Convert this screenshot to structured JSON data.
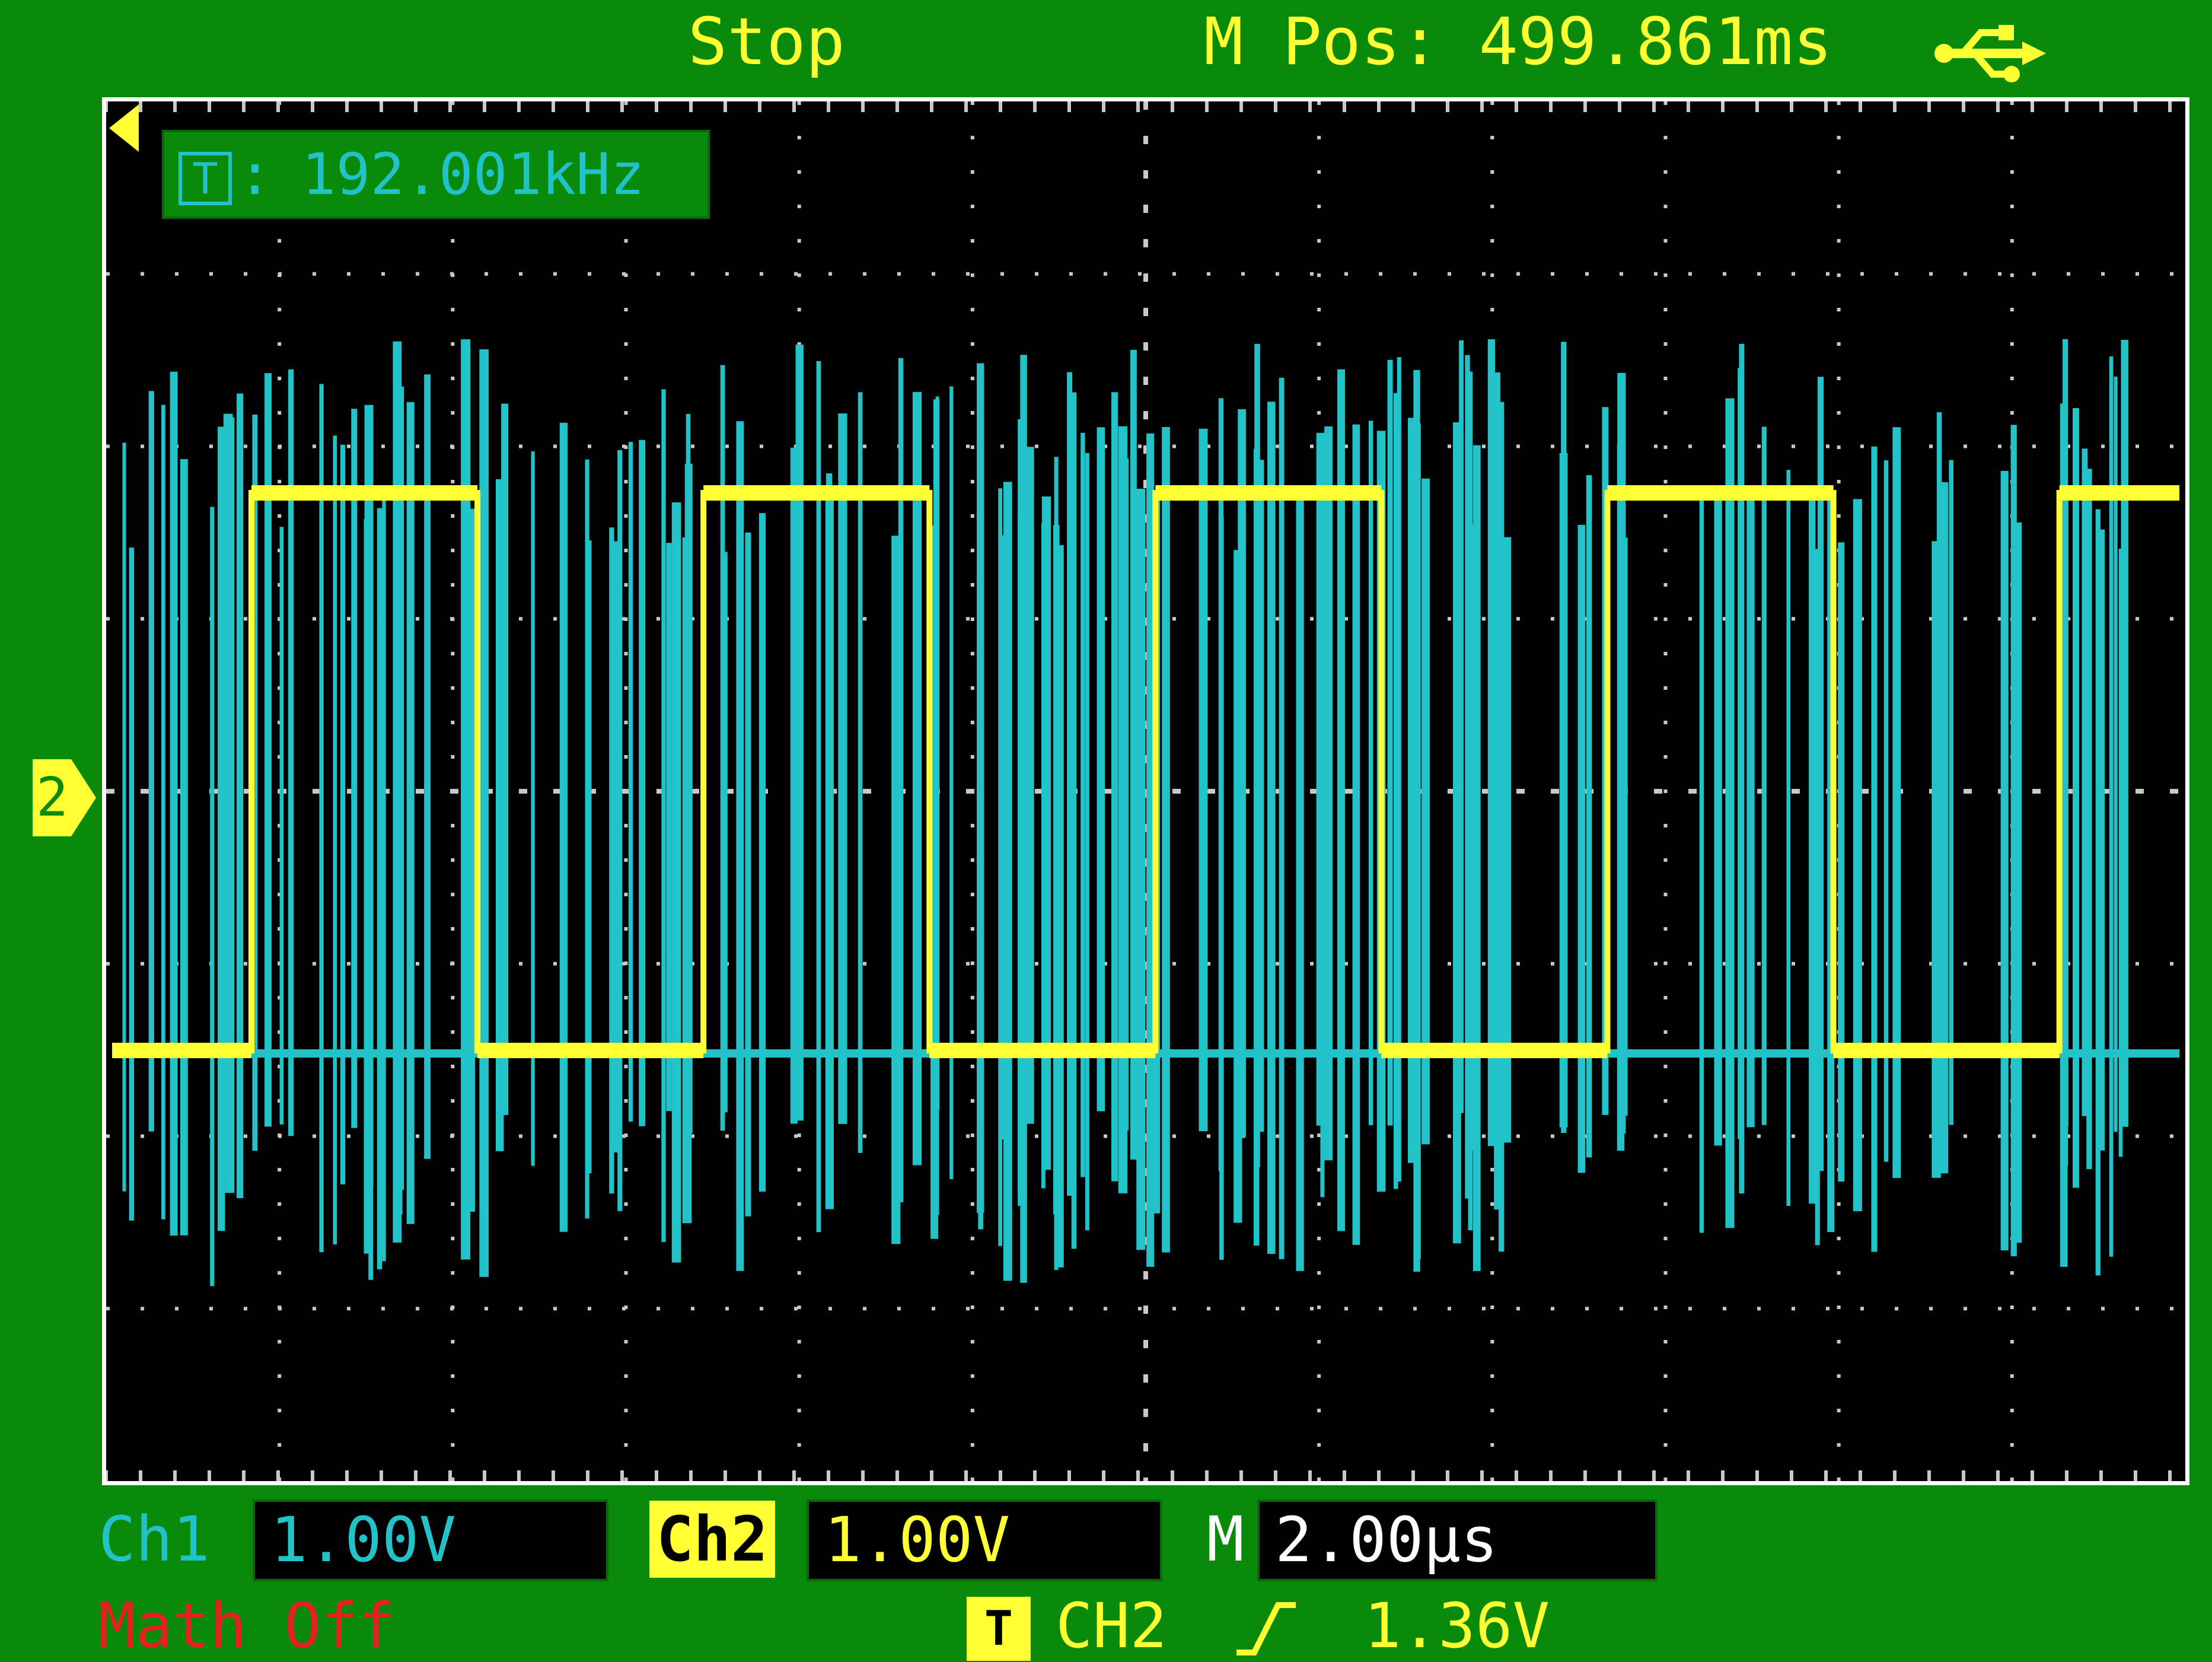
{
  "header": {
    "status": "Stop",
    "mpos": "M Pos: 499.861ms",
    "usb_icon": "usb-icon"
  },
  "screen": {
    "frequency_label": ":",
    "frequency_value": "192.001kHz",
    "trigger_icon_label": "T",
    "ch2_marker_label": "2"
  },
  "footer": {
    "ch1_label": "Ch1",
    "ch1_scale": "1.00V",
    "ch2_label": "Ch2",
    "ch2_scale": "1.00V",
    "m_label": "M",
    "time_scale": "2.00µs",
    "math": "Math Off",
    "trigger_icon_label": "T",
    "trigger_source": "CH2",
    "trigger_level": "1.36V",
    "rising_edge_icon": "rising-edge-icon"
  },
  "colors": {
    "background": "#0a8a0a",
    "ch1_trace": "#22c3c8",
    "ch2_trace": "#ffff33",
    "math": "#e52020"
  }
}
